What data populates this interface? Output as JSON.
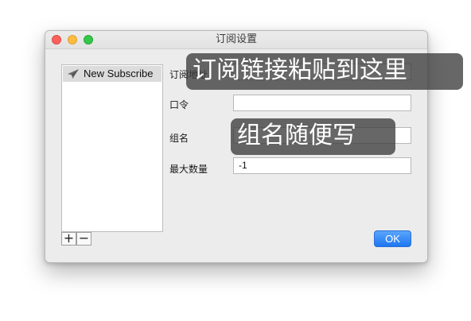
{
  "window": {
    "title": "订阅设置",
    "traffic_lights": [
      "close",
      "minimize",
      "zoom"
    ]
  },
  "sidebar": {
    "items": [
      {
        "label": "New Subscribe",
        "icon": "paper-plane-icon",
        "selected": true
      }
    ],
    "add_label": "+",
    "remove_label": "−"
  },
  "form": {
    "url_label": "订阅地址",
    "url_value": "",
    "password_label": "口令",
    "password_value": "",
    "group_label": "组名",
    "group_value": "",
    "max_count_label": "最大数量",
    "max_count_value": "-1"
  },
  "ok_label": "OK",
  "annotations": {
    "url_hint": "订阅链接粘贴到这里",
    "group_hint": "组名随便写"
  },
  "colors": {
    "accent": "#1e76f2",
    "window_bg": "#ececec",
    "tooltip_bg": "#3c3c3c"
  }
}
